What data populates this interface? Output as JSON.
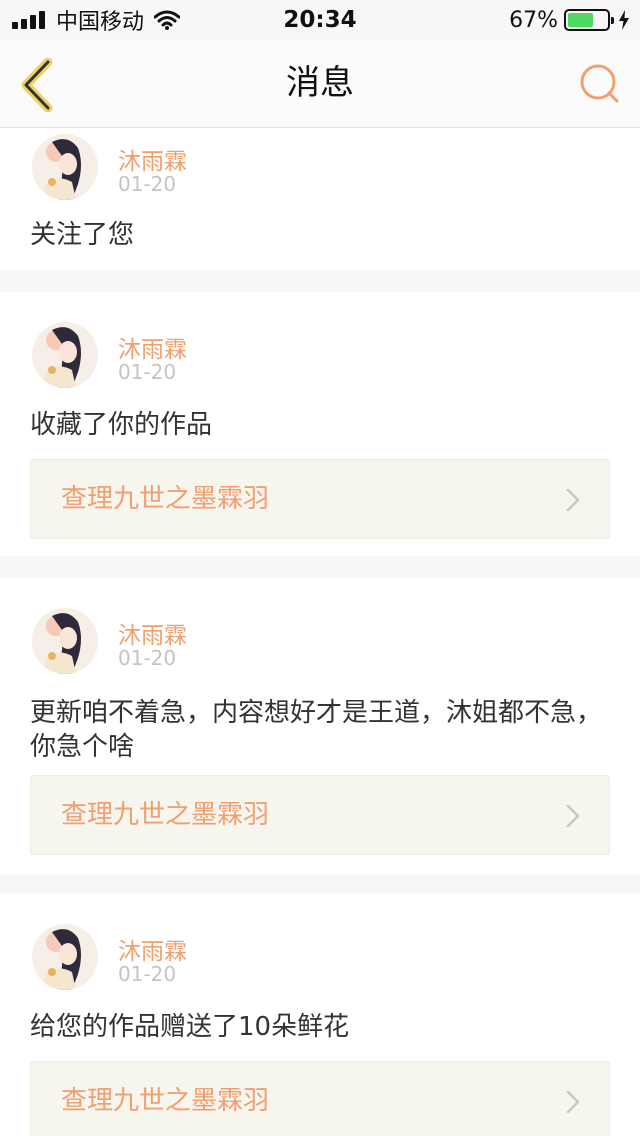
{
  "status_bar": {
    "carrier": "中国移动",
    "time": "20:34",
    "battery_percent": "67%",
    "battery_level": 0.67
  },
  "nav": {
    "title": "消息",
    "back_icon": "chevron-left-icon",
    "search_icon": "search-icon"
  },
  "colors": {
    "accent": "#f0a070",
    "back_arrow": "#f0d060",
    "link_bg": "#f6f5ee",
    "battery": "#4cd964"
  },
  "messages": [
    {
      "user": "沐雨霖",
      "date": "01-20",
      "text": "关注了您"
    },
    {
      "user": "沐雨霖",
      "date": "01-20",
      "text": "收藏了你的作品",
      "work": "查理九世之墨霖羽"
    },
    {
      "user": "沐雨霖",
      "date": "01-20",
      "text": "更新咱不着急，内容想好才是王道，沐姐都不急，你急个啥",
      "work": "查理九世之墨霖羽"
    },
    {
      "user": "沐雨霖",
      "date": "01-20",
      "text": "给您的作品赠送了10朵鲜花",
      "work": "查理九世之墨霖羽"
    }
  ]
}
